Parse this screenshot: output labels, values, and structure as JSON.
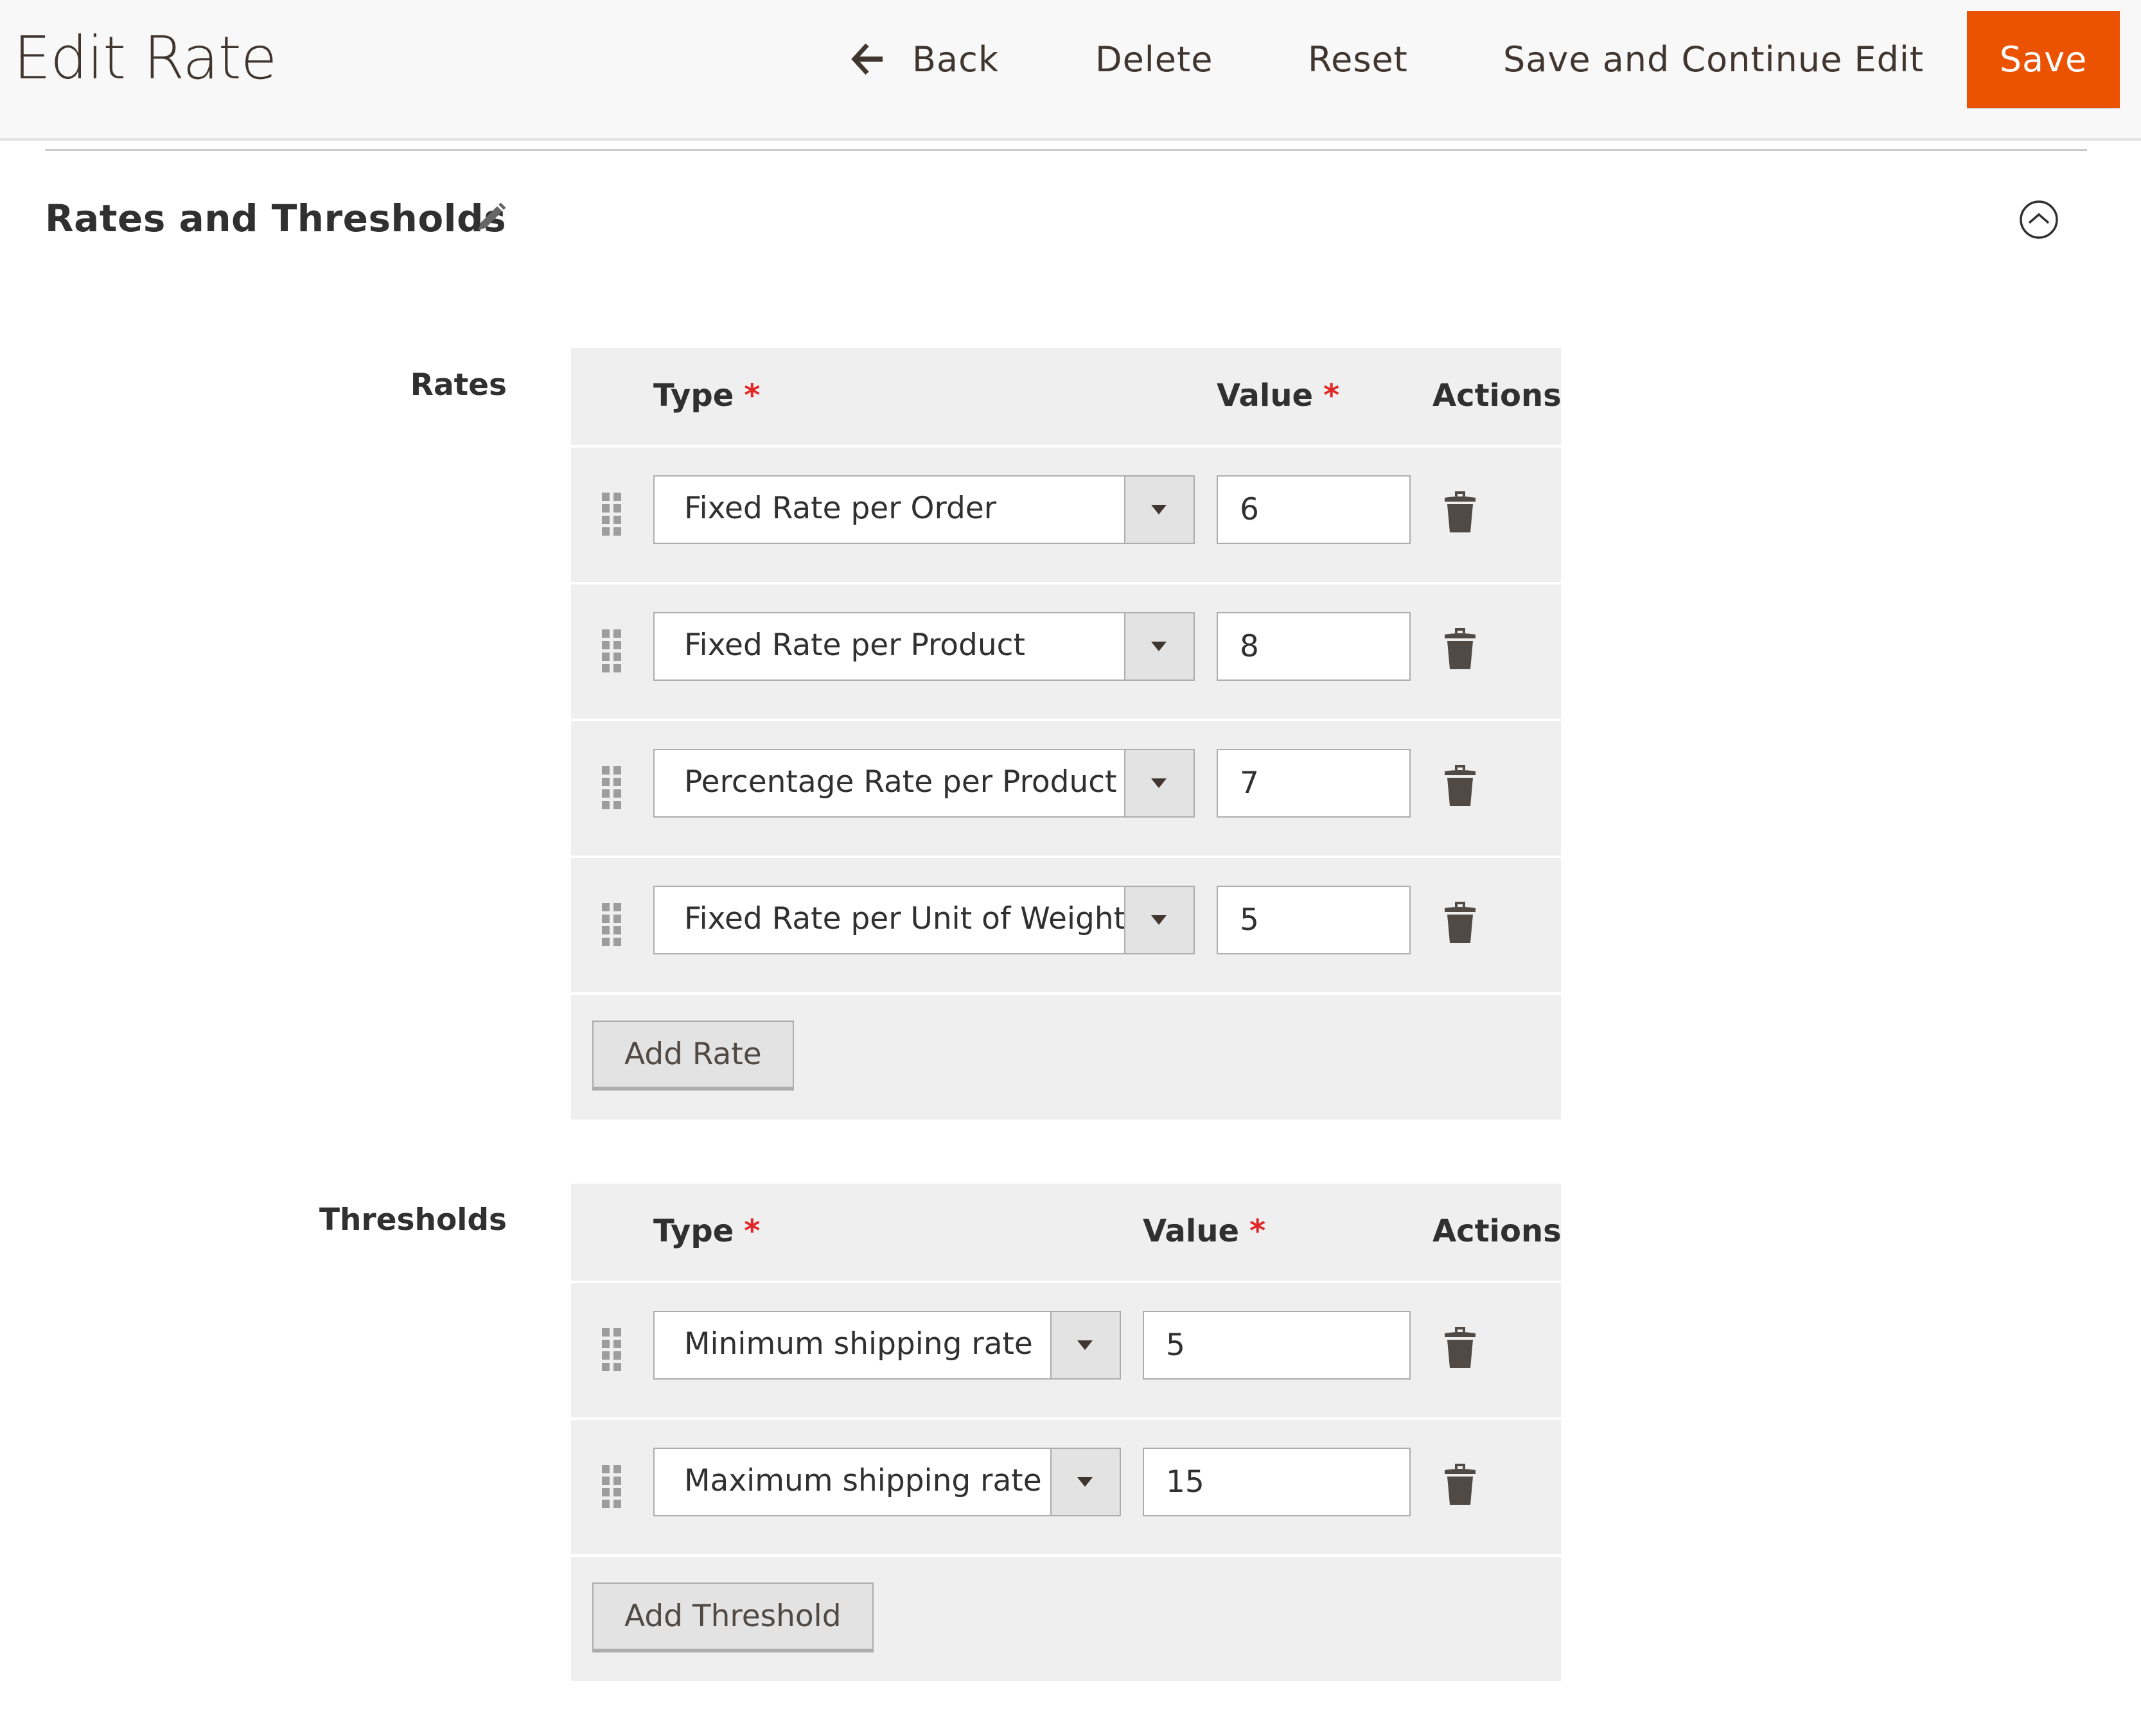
{
  "header": {
    "title": "Edit Rate",
    "back_label": "Back",
    "delete_label": "Delete",
    "reset_label": "Reset",
    "save_continue_label": "Save and Continue Edit",
    "save_label": "Save",
    "save_color": "#eb5202"
  },
  "section": {
    "title": "Rates and Thresholds",
    "edit_icon": "pencil-icon",
    "collapse_icon": "chevron-up-circle-icon"
  },
  "rates": {
    "label": "Rates",
    "columns": {
      "type": "Type",
      "value": "Value",
      "actions": "Actions",
      "required_mark": "*"
    },
    "rows": [
      {
        "type": "Fixed Rate per Order",
        "value": "6"
      },
      {
        "type": "Fixed Rate per Product",
        "value": "8"
      },
      {
        "type": "Percentage Rate per Product",
        "value": "7"
      },
      {
        "type": "Fixed Rate per Unit of Weight",
        "value": "5"
      }
    ],
    "add_label": "Add Rate"
  },
  "thresholds": {
    "label": "Thresholds",
    "columns": {
      "type": "Type",
      "value": "Value",
      "actions": "Actions",
      "required_mark": "*"
    },
    "rows": [
      {
        "type": "Minimum shipping rate",
        "value": "5"
      },
      {
        "type": "Maximum shipping rate",
        "value": "15"
      }
    ],
    "add_label": "Add Threshold"
  }
}
